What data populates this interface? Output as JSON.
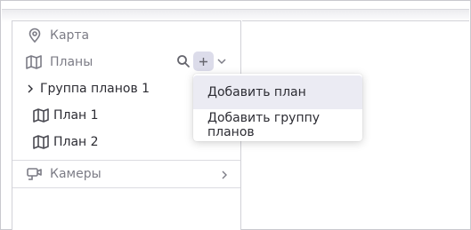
{
  "sidebar": {
    "map": {
      "label": "Карта",
      "icon": "map-pin-icon"
    },
    "plans": {
      "label": "Планы",
      "icon": "map-icon"
    },
    "group": {
      "label": "Группа планов 1",
      "icon": "chevron-right-icon"
    },
    "plan1": {
      "label": "План 1",
      "icon": "map-icon"
    },
    "plan2": {
      "label": "План 2",
      "icon": "map-icon"
    },
    "cameras": {
      "label": "Камеры",
      "icon": "camera-icon"
    }
  },
  "menu": {
    "items": [
      {
        "label": "Добавить план"
      },
      {
        "label": "Добавить группу планов"
      }
    ]
  },
  "colors": {
    "accent_bg": "#dcdcea",
    "text_muted": "#7c7c86",
    "text_dark": "#2c2c33"
  }
}
